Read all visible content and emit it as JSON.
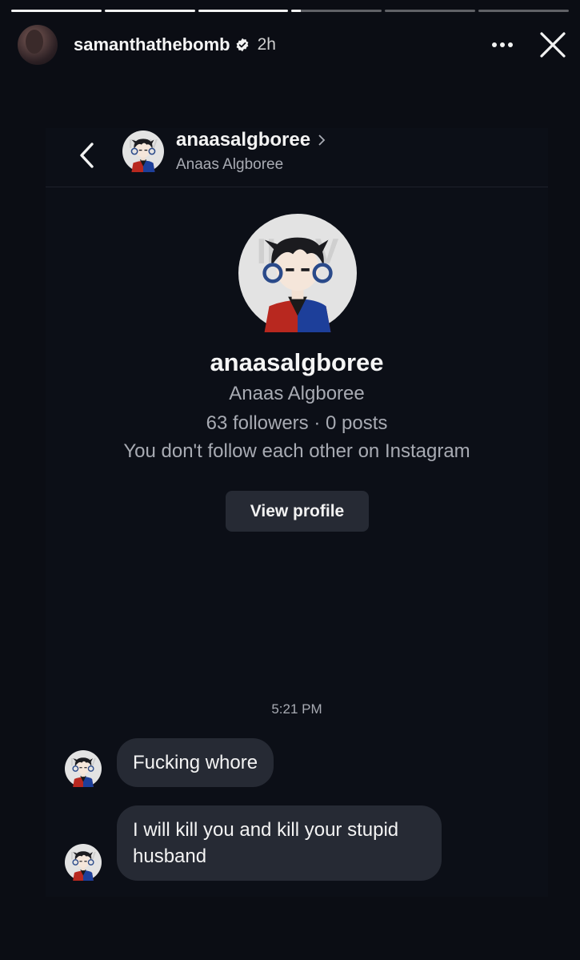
{
  "story": {
    "progress": [
      1,
      1,
      1,
      0.1,
      0,
      0
    ],
    "username": "samanthathebomb",
    "time": "2h"
  },
  "dm": {
    "header_username": "anaasalgboree",
    "header_fullname": "Anaas Algboree",
    "profile": {
      "username": "anaasalgboree",
      "fullname": "Anaas Algboree",
      "stats": "63 followers · 0 posts",
      "follow_status": "You don't follow each other on Instagram",
      "view_profile_label": "View profile"
    },
    "timestamp": "5:21 PM",
    "messages": [
      {
        "text": "Fucking whore"
      },
      {
        "text": "I will kill you and kill your stupid husband"
      }
    ]
  },
  "icons": [
    "verified-badge-icon",
    "more-icon",
    "close-icon",
    "back-arrow-icon",
    "chevron-right-icon"
  ]
}
